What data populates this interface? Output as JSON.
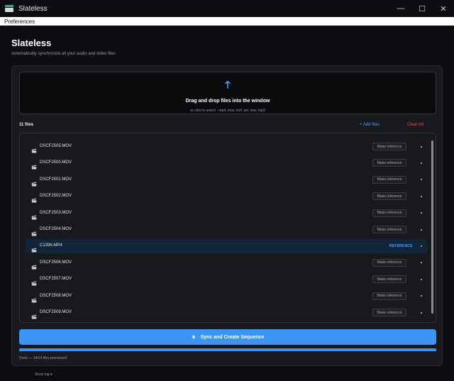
{
  "window": {
    "title": "Slateless",
    "controls": {
      "minimize": "—",
      "maximize": "☐",
      "close": "✕"
    }
  },
  "menu": {
    "items": [
      "Preferences"
    ]
  },
  "header": {
    "title": "Slateless",
    "subtitle": "Automatically synchronize all your audio and video files"
  },
  "dropzone": {
    "icon": "upload-arrow-icon",
    "title": "Drag and drop files into the window",
    "hint": "or click to select  ·  mp4, mov, mxf, avi, wav, mp3"
  },
  "files": {
    "count_label": "11 files",
    "add_label": "+ Add files",
    "clear_label": "Clear list",
    "make_reference_label": "Make reference",
    "reference_label": "REFERENCE",
    "items": [
      {
        "name": "DSCF2505.MOV",
        "is_reference": false
      },
      {
        "name": "DSCF2500.MOV",
        "is_reference": false
      },
      {
        "name": "DSCF2501.MOV",
        "is_reference": false
      },
      {
        "name": "DSCF2502.MOV",
        "is_reference": false
      },
      {
        "name": "DSCF2503.MOV",
        "is_reference": false
      },
      {
        "name": "DSCF2504.MOV",
        "is_reference": false
      },
      {
        "name": "C1396.MP4",
        "is_reference": true
      },
      {
        "name": "DSCF2506.MOV",
        "is_reference": false
      },
      {
        "name": "DSCF2507.MOV",
        "is_reference": false
      },
      {
        "name": "DSCF2508.MOV",
        "is_reference": false
      },
      {
        "name": "DSCF2509.MOV",
        "is_reference": false
      }
    ]
  },
  "actions": {
    "sync_label": "Sync and Create Sequence"
  },
  "progress": {
    "fraction": 1.0,
    "status": "Done — 14/14 files processed"
  },
  "footer": {
    "show_log_label": "Show log ▾"
  },
  "colors": {
    "accent": "#3a95f4",
    "danger": "#e34b4b",
    "reference_row": "#10243a"
  }
}
